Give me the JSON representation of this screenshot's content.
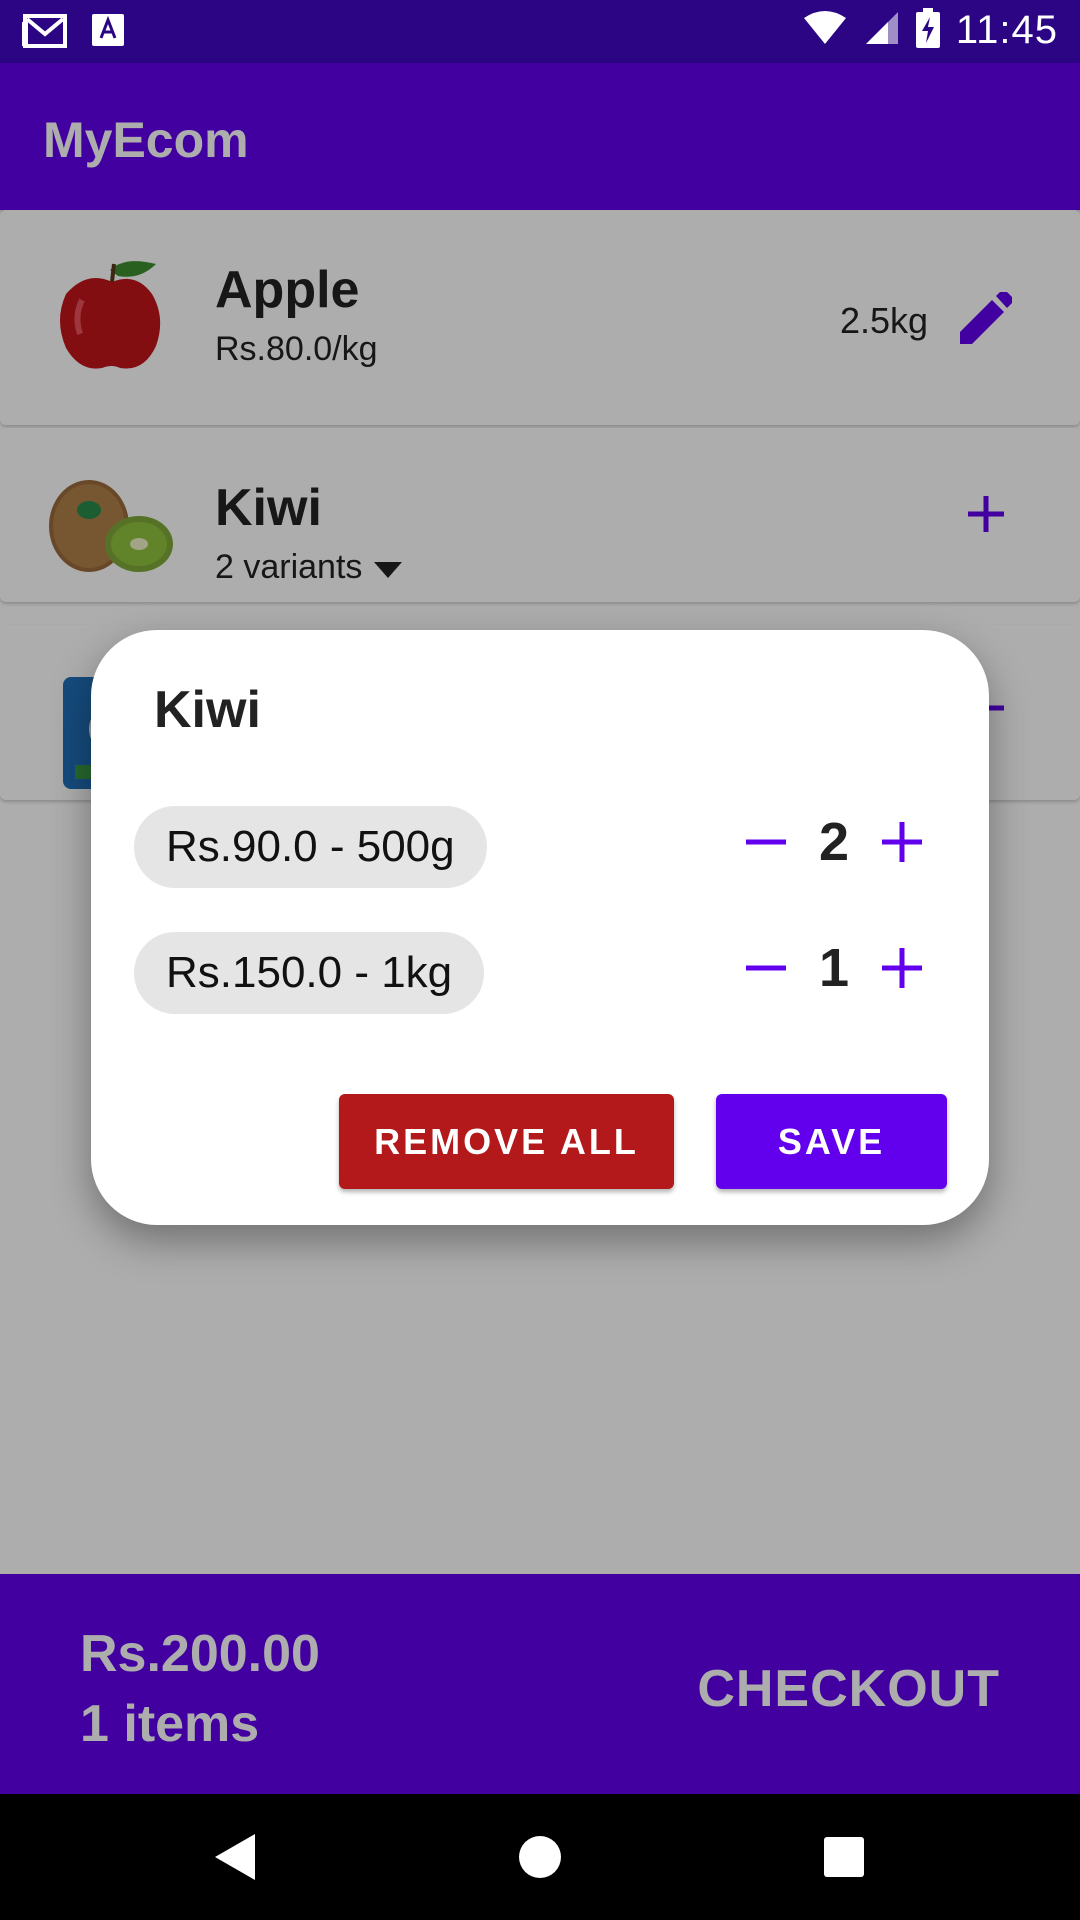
{
  "status_bar": {
    "time": "11:45",
    "icons": [
      "gmail-icon",
      "text-a-icon",
      "wifi-icon",
      "cell-signal-icon",
      "battery-charging-icon"
    ]
  },
  "app_bar": {
    "title": "MyEcom"
  },
  "products": [
    {
      "name": "Apple",
      "subtitle": "Rs.80.0/kg",
      "quantity": "2.5kg",
      "action_icon": "edit-pencil-icon"
    },
    {
      "name": "Kiwi",
      "subtitle": "2 variants",
      "action_icon": "plus-icon"
    },
    {
      "name": "",
      "subtitle": "",
      "action_icon": "minus-icon"
    }
  ],
  "dialog": {
    "title": "Kiwi",
    "variants": [
      {
        "label": "Rs.90.0 - 500g",
        "qty": "2"
      },
      {
        "label": "Rs.150.0 - 1kg",
        "qty": "1"
      }
    ],
    "remove_all_label": "REMOVE ALL",
    "save_label": "SAVE"
  },
  "bottom_bar": {
    "total": "Rs.200.00",
    "items": "1 items",
    "checkout_label": "CHECKOUT"
  },
  "colors": {
    "primary": "#6200ee",
    "status_bar": "#2b0584",
    "danger": "#b3181a",
    "chip": "#e5e5e5"
  }
}
